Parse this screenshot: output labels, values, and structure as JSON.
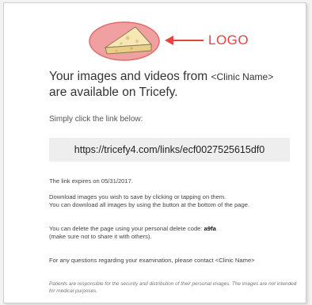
{
  "logo": {
    "label": "LOGO",
    "label_color": "#e8443f",
    "ellipse_fill": "#f0a0a0",
    "ellipse_stroke": "#e26b6b",
    "icon": "cheese-wedge-icon"
  },
  "headline": {
    "line1": "Your images and videos from",
    "clinic_placeholder": "<Clinic Name>",
    "line2": "are available  on Tricefy."
  },
  "instructions": {
    "click_text": "Simply click the link below:"
  },
  "link": {
    "url": "https://tricefy4.com/links/ecf0027525615df0"
  },
  "info": {
    "expires": "The link expires on 05/31/2017.",
    "download_line1": "Download images you wish to save by clicking or tapping on them.",
    "download_line2": "You can download all images by using the button at the bottom of the page.",
    "delete_prefix": "You can delete the page using your personal delete code: ",
    "delete_code": "a9fa",
    "delete_note": "(make sure not to share it with others).",
    "questions_prefix": "For any questions regarding your examination, please contact ",
    "questions_clinic": "<Clinic Name>"
  },
  "disclaimer": {
    "text": "Patients are responsible for the security and distribution of their personal images. The images are not intended for medical purposes."
  }
}
